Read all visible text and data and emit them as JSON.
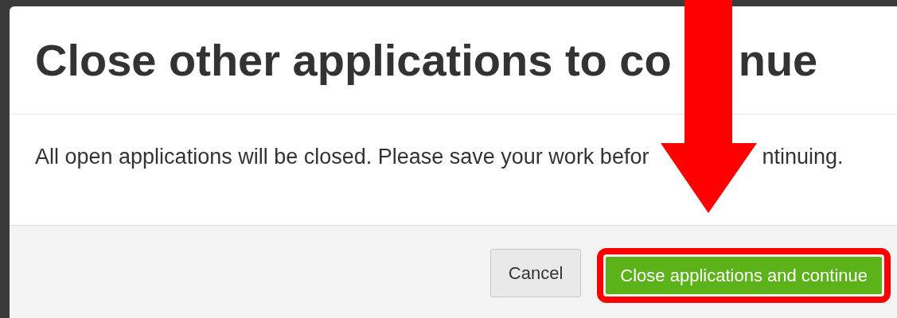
{
  "dialog": {
    "title_parts": [
      "Close other applications to co",
      "nue"
    ],
    "message_parts": [
      "All open applications will be closed. Please save your work befor",
      "ntinuing."
    ],
    "buttons": [
      {
        "label": "Cancel",
        "kind": "secondary",
        "highlighted": false
      },
      {
        "label": "Close applications and continue",
        "kind": "primary",
        "highlighted": true
      }
    ]
  }
}
